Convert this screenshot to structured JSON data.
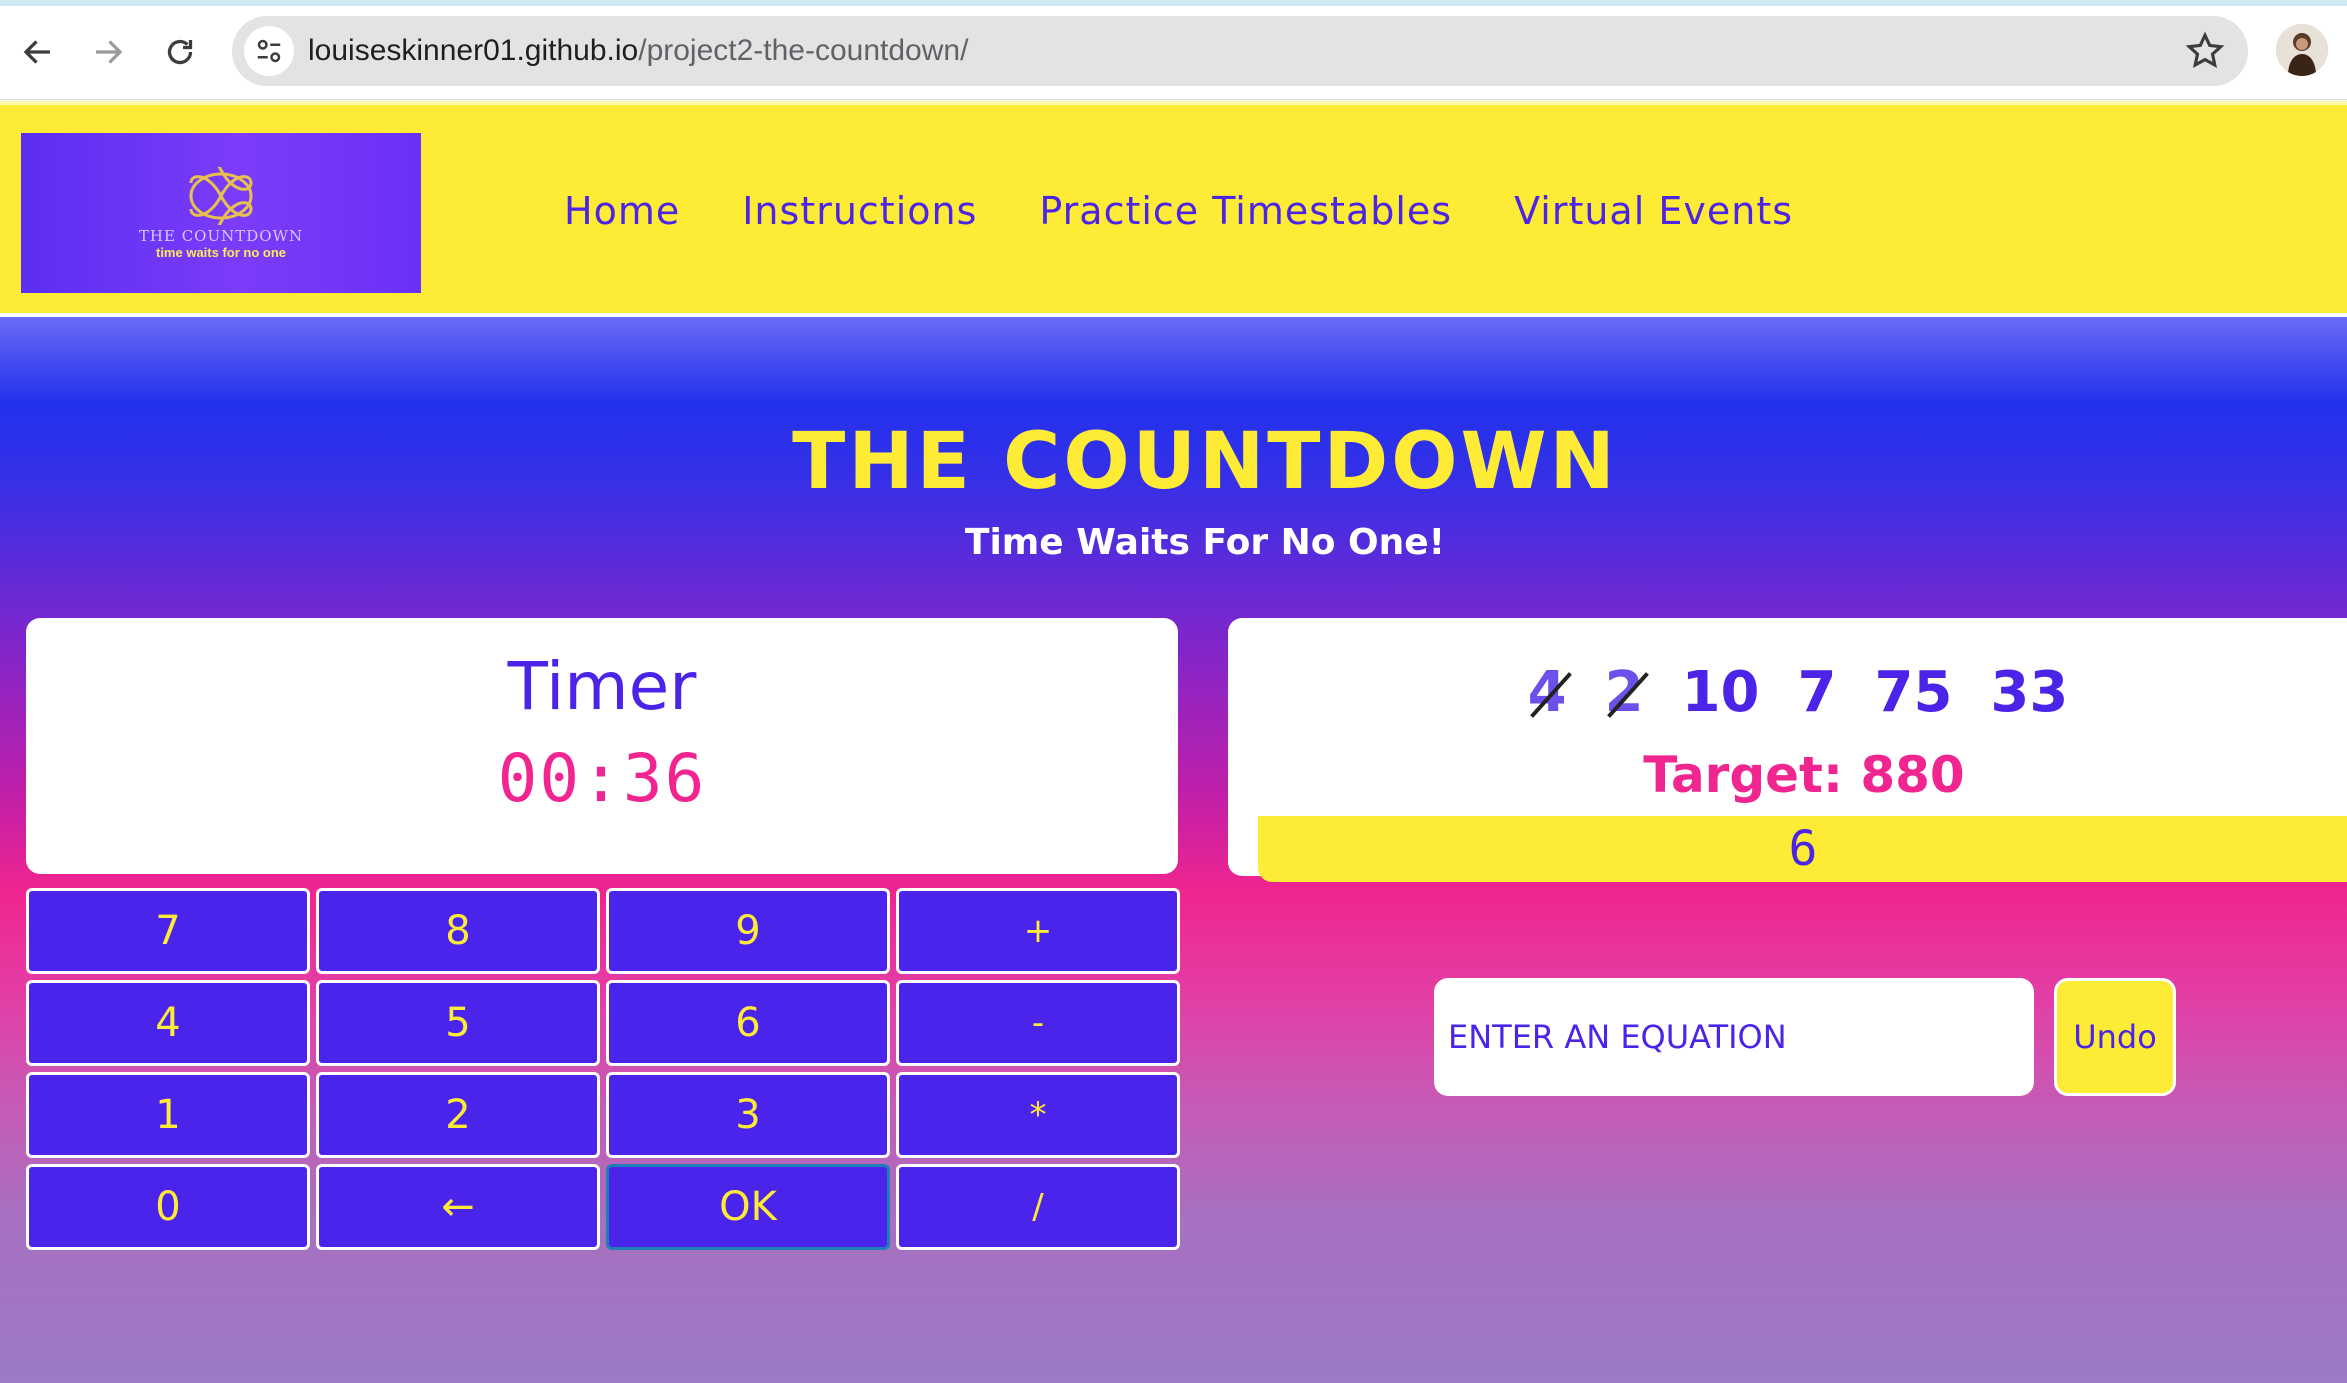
{
  "browser": {
    "url_domain": "louiseskinner01.github.io",
    "url_path": "/project2-the-countdown/",
    "icons": [
      "back-arrow-icon",
      "forward-arrow-icon",
      "reload-icon",
      "site-info-icon",
      "star-icon",
      "profile-avatar"
    ]
  },
  "header": {
    "logo_title": "THE COUNTDOWN",
    "logo_tagline": "time waits for no one",
    "nav": [
      "Home",
      "Instructions",
      "Practice Timestables",
      "Virtual Events"
    ]
  },
  "hero": {
    "title": "THE COUNTDOWN",
    "subtitle": "Time Waits For No One!"
  },
  "timer": {
    "label": "Timer",
    "value": "00:36"
  },
  "keypad": [
    "7",
    "8",
    "9",
    "+",
    "4",
    "5",
    "6",
    "-",
    "1",
    "2",
    "3",
    "*",
    "0",
    "←",
    "OK",
    "/"
  ],
  "numbers": [
    {
      "value": "4",
      "used": true
    },
    {
      "value": "2",
      "used": true
    },
    {
      "value": "10",
      "used": false
    },
    {
      "value": "7",
      "used": false
    },
    {
      "value": "75",
      "used": false
    },
    {
      "value": "33",
      "used": false
    }
  ],
  "target_text": "Target: 880",
  "result": "6",
  "equation": {
    "placeholder": "ENTER AN EQUATION",
    "value": ""
  },
  "undo_label": "Undo",
  "colors": {
    "yellow": "#feeb35",
    "purple": "#4b24e8",
    "pink": "#f0258f"
  }
}
